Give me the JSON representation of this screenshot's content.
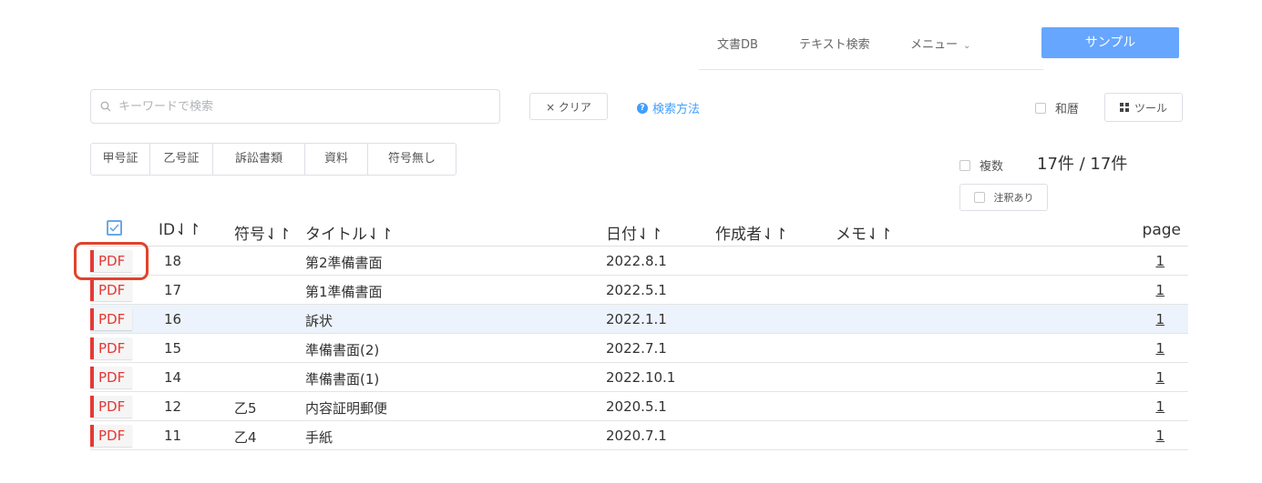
{
  "nav": {
    "items": [
      "文書DB",
      "テキスト検索",
      "メニュー"
    ],
    "sample_button": "サンプル"
  },
  "search": {
    "placeholder": "キーワードで検索",
    "value": "",
    "clear_label": "× クリア",
    "help_label": "検索方法",
    "wareki_label": "和暦",
    "tool_label": "ツール"
  },
  "categories": [
    "甲号証",
    "乙号証",
    "訴訟書類",
    "資料",
    "符号無し"
  ],
  "options": {
    "multi_label": "複数",
    "count_text": "17件 / 17件",
    "note_label": "注釈あり"
  },
  "table": {
    "headers": {
      "id": "ID⇃↾",
      "code": "符号⇃↾",
      "title": "タイトル⇃↾",
      "date": "日付⇃↾",
      "author": "作成者⇃↾",
      "memo": "メモ⇃↾",
      "page": "page"
    },
    "pdf_label": "PDF",
    "rows": [
      {
        "id": "18",
        "code": "",
        "title": "第2準備書面",
        "date": "2022.8.1",
        "author": "",
        "memo": "",
        "page": "1"
      },
      {
        "id": "17",
        "code": "",
        "title": "第1準備書面",
        "date": "2022.5.1",
        "author": "",
        "memo": "",
        "page": "1"
      },
      {
        "id": "16",
        "code": "",
        "title": "訴状",
        "date": "2022.1.1",
        "author": "",
        "memo": "",
        "page": "1"
      },
      {
        "id": "15",
        "code": "",
        "title": "準備書面(2)",
        "date": "2022.7.1",
        "author": "",
        "memo": "",
        "page": "1"
      },
      {
        "id": "14",
        "code": "",
        "title": "準備書面(1)",
        "date": "2022.10.1",
        "author": "",
        "memo": "",
        "page": "1"
      },
      {
        "id": "12",
        "code": "乙5",
        "title": "内容証明郵便",
        "date": "2020.5.1",
        "author": "",
        "memo": "",
        "page": "1"
      },
      {
        "id": "11",
        "code": "乙4",
        "title": "手紙",
        "date": "2020.7.1",
        "author": "",
        "memo": "",
        "page": "1"
      }
    ]
  },
  "colors": {
    "accent": "#66a6ff",
    "link": "#409eff",
    "pdf": "#e53935",
    "highlight_row": "#edf3fc",
    "annotation_frame": "#e0432b"
  }
}
